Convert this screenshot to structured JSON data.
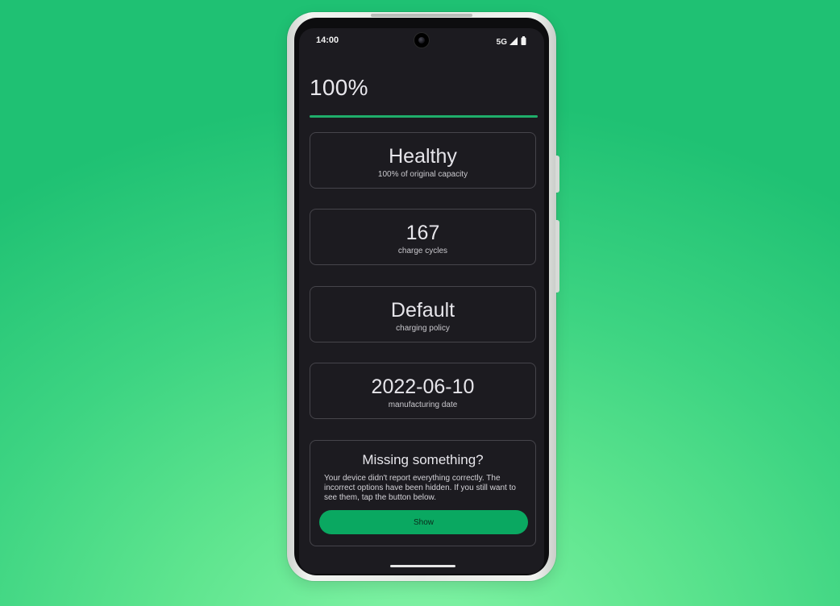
{
  "status_bar": {
    "time": "14:00",
    "network": "5G",
    "icons": [
      "signal-icon",
      "battery-icon"
    ]
  },
  "header": {
    "percent": "100%",
    "progress": 1.0
  },
  "cards": [
    {
      "value": "Healthy",
      "label": "100% of original capacity"
    },
    {
      "value": "167",
      "label": "charge cycles"
    },
    {
      "value": "Default",
      "label": "charging policy"
    },
    {
      "value": "2022-06-10",
      "label": "manufacturing date"
    }
  ],
  "missing": {
    "title": "Missing something?",
    "body": "Your device didn't report everything correctly. The incorrect options have been hidden. If you still want to see them, tap the button below.",
    "button_label": "Show"
  },
  "colors": {
    "accent": "#1fae6a",
    "button": "#0aa861",
    "screen_bg": "#1c1b20",
    "background": "#3dd482"
  }
}
